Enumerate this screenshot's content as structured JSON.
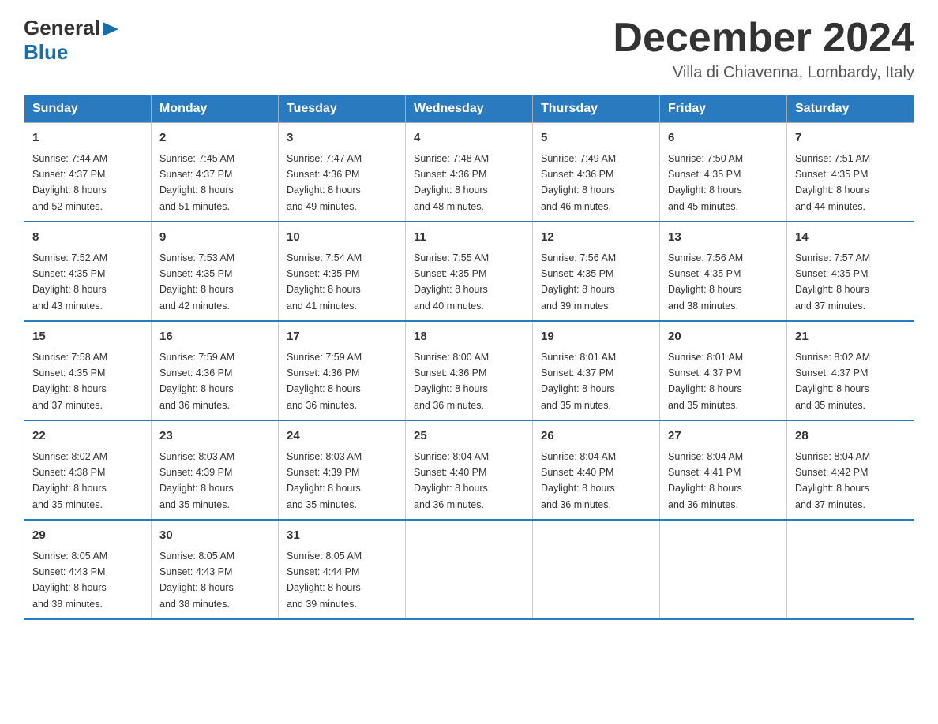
{
  "header": {
    "logo_line1": "General",
    "logo_line2": "Blue",
    "title": "December 2024",
    "subtitle": "Villa di Chiavenna, Lombardy, Italy"
  },
  "days_of_week": [
    "Sunday",
    "Monday",
    "Tuesday",
    "Wednesday",
    "Thursday",
    "Friday",
    "Saturday"
  ],
  "weeks": [
    [
      {
        "day": "1",
        "sunrise": "7:44 AM",
        "sunset": "4:37 PM",
        "daylight": "8 hours and 52 minutes."
      },
      {
        "day": "2",
        "sunrise": "7:45 AM",
        "sunset": "4:37 PM",
        "daylight": "8 hours and 51 minutes."
      },
      {
        "day": "3",
        "sunrise": "7:47 AM",
        "sunset": "4:36 PM",
        "daylight": "8 hours and 49 minutes."
      },
      {
        "day": "4",
        "sunrise": "7:48 AM",
        "sunset": "4:36 PM",
        "daylight": "8 hours and 48 minutes."
      },
      {
        "day": "5",
        "sunrise": "7:49 AM",
        "sunset": "4:36 PM",
        "daylight": "8 hours and 46 minutes."
      },
      {
        "day": "6",
        "sunrise": "7:50 AM",
        "sunset": "4:35 PM",
        "daylight": "8 hours and 45 minutes."
      },
      {
        "day": "7",
        "sunrise": "7:51 AM",
        "sunset": "4:35 PM",
        "daylight": "8 hours and 44 minutes."
      }
    ],
    [
      {
        "day": "8",
        "sunrise": "7:52 AM",
        "sunset": "4:35 PM",
        "daylight": "8 hours and 43 minutes."
      },
      {
        "day": "9",
        "sunrise": "7:53 AM",
        "sunset": "4:35 PM",
        "daylight": "8 hours and 42 minutes."
      },
      {
        "day": "10",
        "sunrise": "7:54 AM",
        "sunset": "4:35 PM",
        "daylight": "8 hours and 41 minutes."
      },
      {
        "day": "11",
        "sunrise": "7:55 AM",
        "sunset": "4:35 PM",
        "daylight": "8 hours and 40 minutes."
      },
      {
        "day": "12",
        "sunrise": "7:56 AM",
        "sunset": "4:35 PM",
        "daylight": "8 hours and 39 minutes."
      },
      {
        "day": "13",
        "sunrise": "7:56 AM",
        "sunset": "4:35 PM",
        "daylight": "8 hours and 38 minutes."
      },
      {
        "day": "14",
        "sunrise": "7:57 AM",
        "sunset": "4:35 PM",
        "daylight": "8 hours and 37 minutes."
      }
    ],
    [
      {
        "day": "15",
        "sunrise": "7:58 AM",
        "sunset": "4:35 PM",
        "daylight": "8 hours and 37 minutes."
      },
      {
        "day": "16",
        "sunrise": "7:59 AM",
        "sunset": "4:36 PM",
        "daylight": "8 hours and 36 minutes."
      },
      {
        "day": "17",
        "sunrise": "7:59 AM",
        "sunset": "4:36 PM",
        "daylight": "8 hours and 36 minutes."
      },
      {
        "day": "18",
        "sunrise": "8:00 AM",
        "sunset": "4:36 PM",
        "daylight": "8 hours and 36 minutes."
      },
      {
        "day": "19",
        "sunrise": "8:01 AM",
        "sunset": "4:37 PM",
        "daylight": "8 hours and 35 minutes."
      },
      {
        "day": "20",
        "sunrise": "8:01 AM",
        "sunset": "4:37 PM",
        "daylight": "8 hours and 35 minutes."
      },
      {
        "day": "21",
        "sunrise": "8:02 AM",
        "sunset": "4:37 PM",
        "daylight": "8 hours and 35 minutes."
      }
    ],
    [
      {
        "day": "22",
        "sunrise": "8:02 AM",
        "sunset": "4:38 PM",
        "daylight": "8 hours and 35 minutes."
      },
      {
        "day": "23",
        "sunrise": "8:03 AM",
        "sunset": "4:39 PM",
        "daylight": "8 hours and 35 minutes."
      },
      {
        "day": "24",
        "sunrise": "8:03 AM",
        "sunset": "4:39 PM",
        "daylight": "8 hours and 35 minutes."
      },
      {
        "day": "25",
        "sunrise": "8:04 AM",
        "sunset": "4:40 PM",
        "daylight": "8 hours and 36 minutes."
      },
      {
        "day": "26",
        "sunrise": "8:04 AM",
        "sunset": "4:40 PM",
        "daylight": "8 hours and 36 minutes."
      },
      {
        "day": "27",
        "sunrise": "8:04 AM",
        "sunset": "4:41 PM",
        "daylight": "8 hours and 36 minutes."
      },
      {
        "day": "28",
        "sunrise": "8:04 AM",
        "sunset": "4:42 PM",
        "daylight": "8 hours and 37 minutes."
      }
    ],
    [
      {
        "day": "29",
        "sunrise": "8:05 AM",
        "sunset": "4:43 PM",
        "daylight": "8 hours and 38 minutes."
      },
      {
        "day": "30",
        "sunrise": "8:05 AM",
        "sunset": "4:43 PM",
        "daylight": "8 hours and 38 minutes."
      },
      {
        "day": "31",
        "sunrise": "8:05 AM",
        "sunset": "4:44 PM",
        "daylight": "8 hours and 39 minutes."
      },
      null,
      null,
      null,
      null
    ]
  ],
  "labels": {
    "sunrise_prefix": "Sunrise: ",
    "sunset_prefix": "Sunset: ",
    "daylight_prefix": "Daylight: "
  }
}
